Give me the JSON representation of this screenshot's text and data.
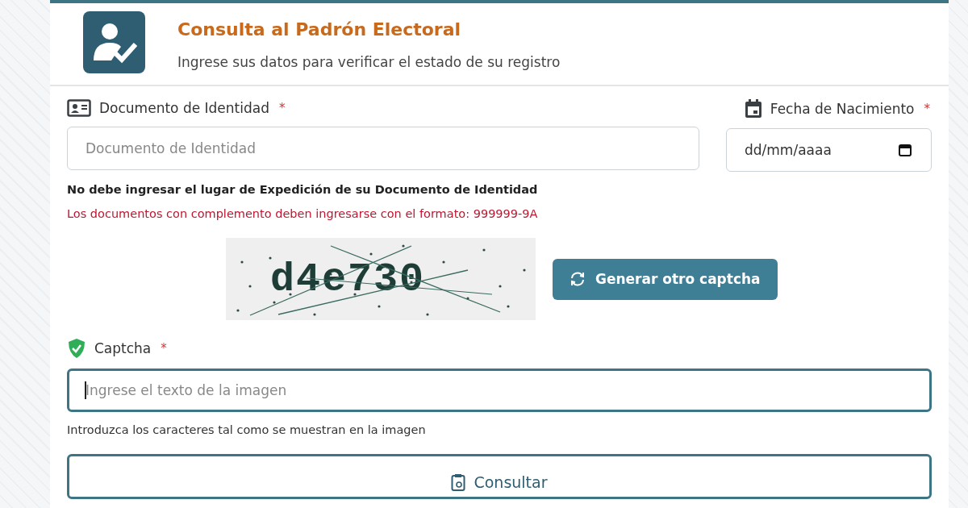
{
  "header": {
    "title": "Consulta al Padrón Electoral",
    "subtitle": "Ingrese sus datos para verificar el estado de su registro"
  },
  "fields": [
    {
      "kind": "text",
      "label": "Documento de Identidad",
      "required": "*",
      "placeholder": "Documento de Identidad"
    },
    {
      "kind": "date",
      "label": "Fecha de Nacimiento",
      "required": "*",
      "value": "dd/mm/aaaa"
    }
  ],
  "notes": [
    {
      "kind": "info",
      "text": "No debe ingresar el lugar de Expedición de su Documento de Identidad"
    },
    {
      "kind": "warning",
      "text": "Los documentos con complemento deben ingresarse con el formato: 999999-9A"
    }
  ],
  "captcha": {
    "image_text": "d4e730",
    "refresh_button": "Generar otro captcha",
    "label": "Captcha",
    "required": "*",
    "placeholder": "Ingrese el texto de la imagen",
    "focused": true,
    "help": "Introduzca los caracteres tal como se muestran en la imagen"
  },
  "submit_button": "Consultar"
}
